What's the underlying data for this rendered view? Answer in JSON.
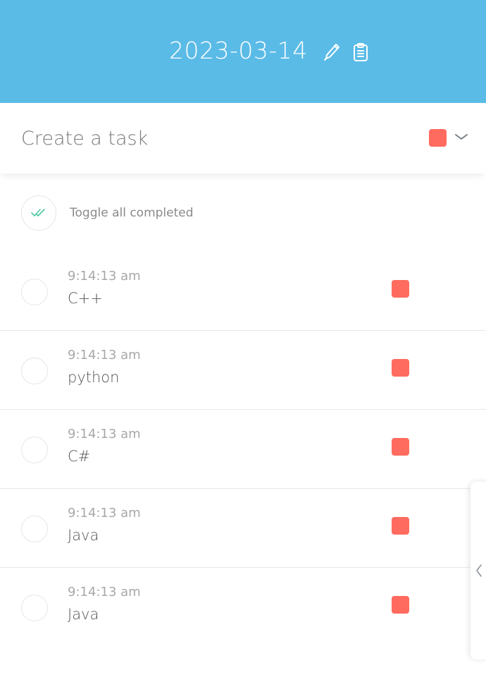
{
  "header": {
    "title": "2023-03-14",
    "bg_color": "#5bbbe7",
    "icons": [
      "pencil-icon",
      "clipboard-icon"
    ]
  },
  "create": {
    "placeholder": "Create a task",
    "selected_color": "#ff6b5f"
  },
  "toggle_all": {
    "label": "Toggle all completed",
    "icon": "double-check-icon",
    "icon_color": "#4cc9a3"
  },
  "tasks": [
    {
      "time": "9:14:13 am",
      "name": "C++",
      "color": "#ff6b5f"
    },
    {
      "time": "9:14:13 am",
      "name": "python",
      "color": "#ff6b5f"
    },
    {
      "time": "9:14:13 am",
      "name": "C#",
      "color": "#ff6b5f"
    },
    {
      "time": "9:14:13 am",
      "name": "Java",
      "color": "#ff6b5f"
    },
    {
      "time": "9:14:13 am",
      "name": "Java",
      "color": "#ff6b5f"
    }
  ],
  "side_panel": {
    "icon": "chevron-left-icon"
  }
}
